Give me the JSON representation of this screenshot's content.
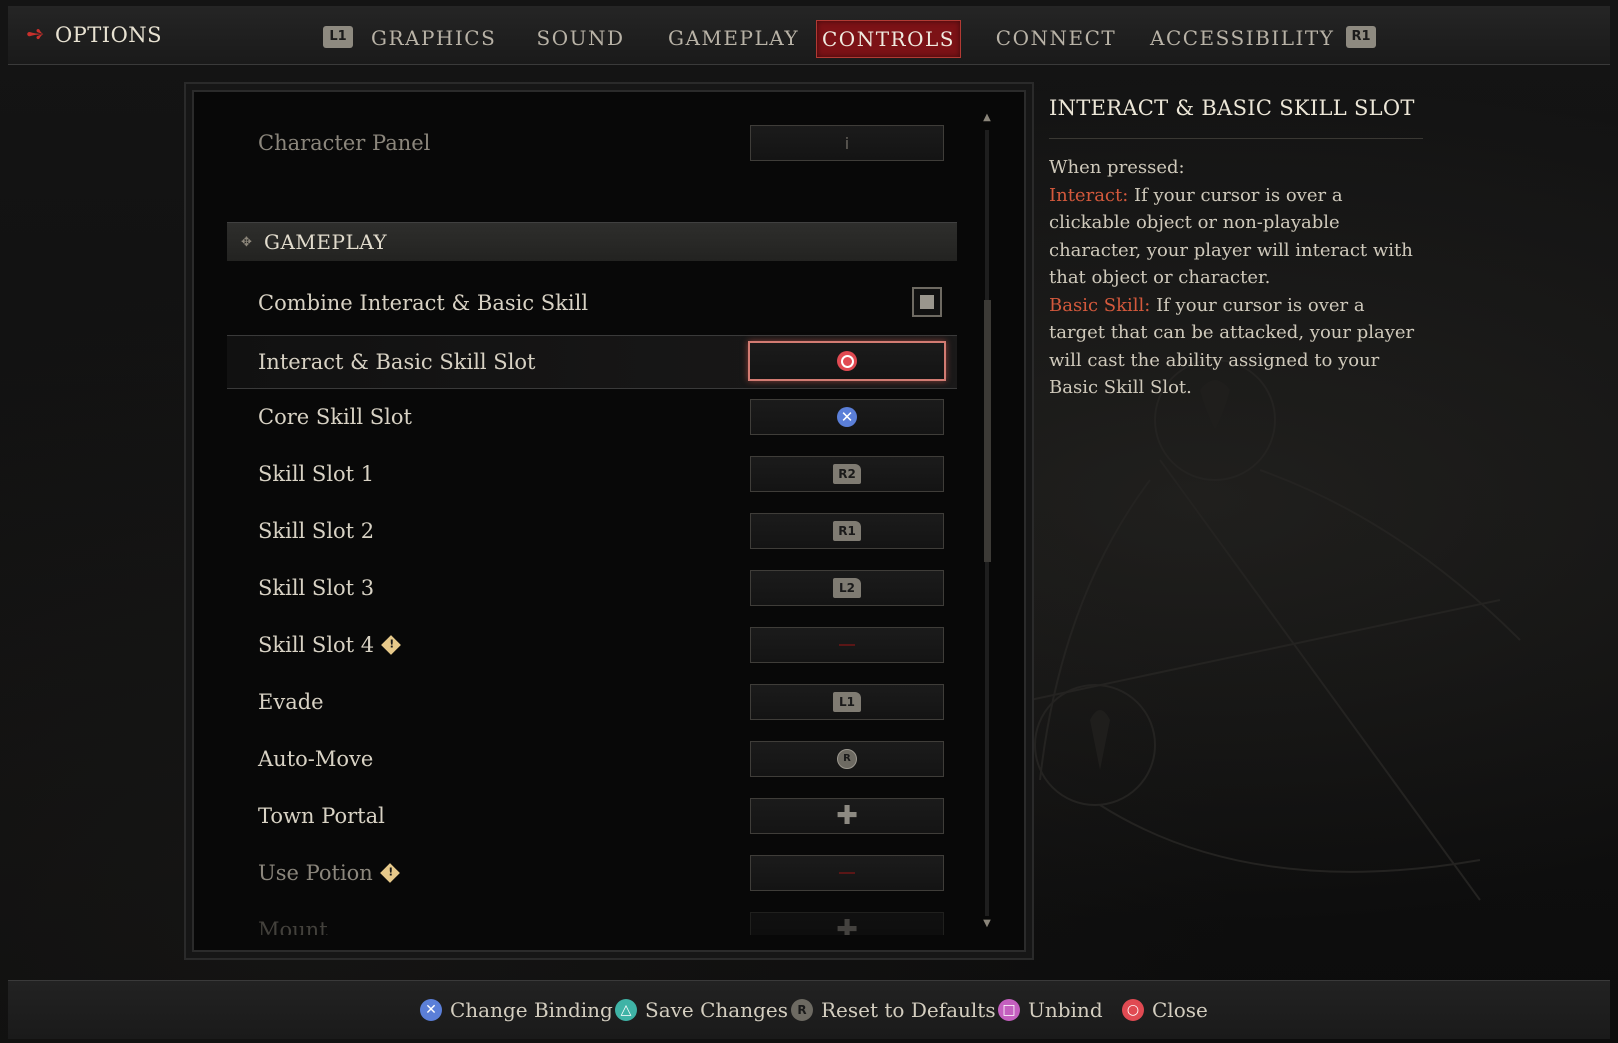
{
  "header": {
    "title": "OPTIONS",
    "title_icon": "back-arrow-icon",
    "left_shoulder": "L1",
    "right_shoulder": "R1",
    "tabs": [
      {
        "label": "GRAPHICS",
        "active": false
      },
      {
        "label": "SOUND",
        "active": false
      },
      {
        "label": "GAMEPLAY",
        "active": false
      },
      {
        "label": "CONTROLS",
        "active": true
      },
      {
        "label": "CONNECT",
        "active": false
      },
      {
        "label": "ACCESSIBILITY",
        "active": false
      }
    ]
  },
  "settings": {
    "top_row": {
      "label": "Character Panel",
      "binding": "i"
    },
    "section": "GAMEPLAY",
    "combine_toggle": {
      "label": "Combine Interact & Basic Skill",
      "checked": true
    },
    "rows": [
      {
        "label": "Interact & Basic Skill Slot",
        "binding": "circle"
      },
      {
        "label": "Core Skill Slot",
        "binding": "cross"
      },
      {
        "label": "Skill Slot 1",
        "binding": "R2"
      },
      {
        "label": "Skill Slot 2",
        "binding": "R1"
      },
      {
        "label": "Skill Slot 3",
        "binding": "L2"
      },
      {
        "label": "Skill Slot 4",
        "binding": "—",
        "warning": true
      },
      {
        "label": "Evade",
        "binding": "L1"
      },
      {
        "label": "Auto-Move",
        "binding": "R"
      },
      {
        "label": "Town Portal",
        "binding": "dpad"
      },
      {
        "label": "Use Potion",
        "binding": "—",
        "warning": true
      },
      {
        "label": "Mount",
        "binding": "dpad"
      }
    ],
    "selected_row": "Interact & Basic Skill Slot"
  },
  "info": {
    "title": "INTERACT & BASIC SKILL SLOT",
    "intro": "When pressed:",
    "interact_keyword": "Interact:",
    "interact_text": " If your cursor is over a clickable object or non-playable character, your player will interact with that object or character.",
    "basic_keyword": "Basic Skill:",
    "basic_text": " If your cursor is over a target that can be attacked, your player will cast the ability assigned to your Basic Skill Slot."
  },
  "footer": {
    "hints": [
      {
        "button": "cross",
        "label": "Change Binding",
        "color": "#5b7fd8"
      },
      {
        "button": "triangle",
        "label": "Save Changes",
        "color": "#3fb3a6"
      },
      {
        "button": "R",
        "label": "Reset to Defaults",
        "color": "#6d6a62"
      },
      {
        "button": "square",
        "label": "Unbind",
        "color": "#c45fbf"
      },
      {
        "button": "circle",
        "label": "Close",
        "color": "#e04a52"
      }
    ]
  },
  "colors": {
    "active_tab": "#7c1216",
    "keyword": "#d4593c",
    "selection_border": "#d27b72"
  }
}
